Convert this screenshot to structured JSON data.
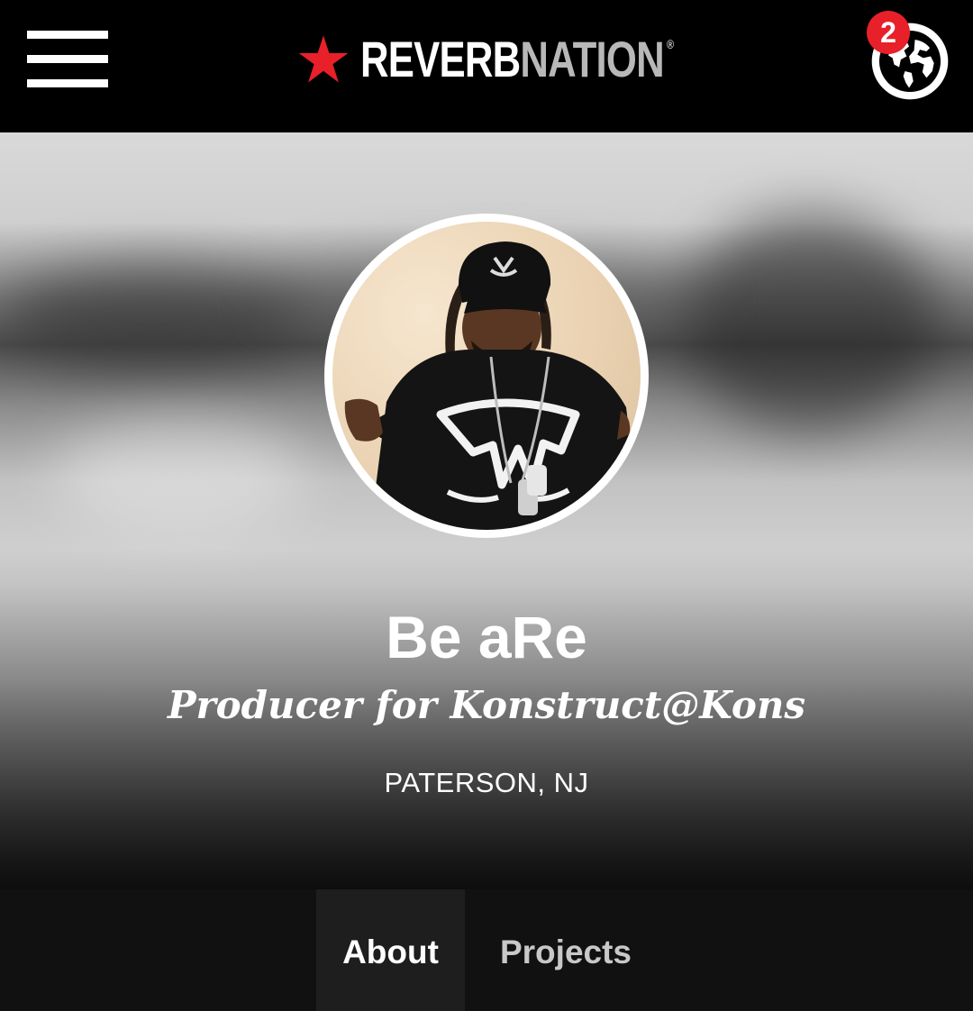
{
  "header": {
    "logo_primary": "REVERB",
    "logo_secondary": "NATION",
    "logo_registered": "®",
    "notification_count": "2",
    "icons": [
      "menu-icon",
      "star-icon",
      "globe-icon"
    ],
    "colors": {
      "brand_red": "#e8202a",
      "background": "#000000"
    }
  },
  "profile": {
    "name": "Be aRe",
    "tagline": "Producer for Konstruct@Kons",
    "location": "PATERSON, NJ"
  },
  "tabs": [
    {
      "label": "About",
      "active": true
    },
    {
      "label": "Projects",
      "active": false
    }
  ]
}
